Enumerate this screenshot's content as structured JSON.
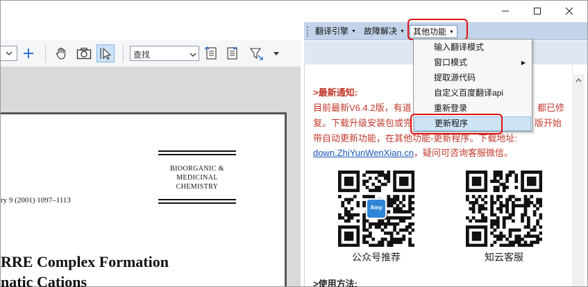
{
  "window": {
    "controls": {
      "minimize_icon": "minimize-icon",
      "maximize_icon": "maximize-icon",
      "close_icon": "close-icon"
    }
  },
  "pdf_toolbar": {
    "find_placeholder": "查找",
    "tools": [
      "add-icon",
      "hand-icon",
      "snapshot-icon",
      "select-cursor-icon",
      "find-icon",
      "page-icon",
      "filter-icon"
    ]
  },
  "document": {
    "journal_name": [
      "BIOORGANIC &",
      "MEDICINAL",
      "CHEMISTRY"
    ],
    "citation": "ry 9 (2001) 1097–1113",
    "title_lines": [
      "RRE Complex Formation",
      "natic Cations"
    ]
  },
  "translate_panel": {
    "menus": {
      "engine": "翻译引擎",
      "troubleshoot": "故障解决",
      "other": "其他功能"
    },
    "other_menu_items": [
      {
        "label": "输入翻译模式"
      },
      {
        "label": "窗口模式",
        "submenu": true
      },
      {
        "label": "提取源代码"
      },
      {
        "label": "自定义百度翻译api"
      },
      {
        "label": "重新登录"
      },
      {
        "label": "更新程序"
      }
    ],
    "notice": {
      "heading": ">最新通知:",
      "lines": [
        "目前最新V6.4.2版，有道",
        "复。下载升级安装包或完",
        "带自动更新功能，在其他功能-更新程序。下载地址:"
      ],
      "right_fragments": [
        "都已修",
        "版开始"
      ],
      "link": "down.ZhiYunWenXian.cn",
      "link_suffix": "，疑问可咨询客服微信。"
    },
    "qr_codes": [
      {
        "caption": "公众号推荐",
        "badge": "Amy"
      },
      {
        "caption": "知云客服"
      }
    ],
    "howto": ">使用方法:"
  },
  "colors": {
    "accent_red": "#e01010",
    "notice_red": "#c0392b",
    "link_blue": "#1a56b8",
    "menubar_blue": "#c3d4ea",
    "highlight": "#cde4f7"
  }
}
